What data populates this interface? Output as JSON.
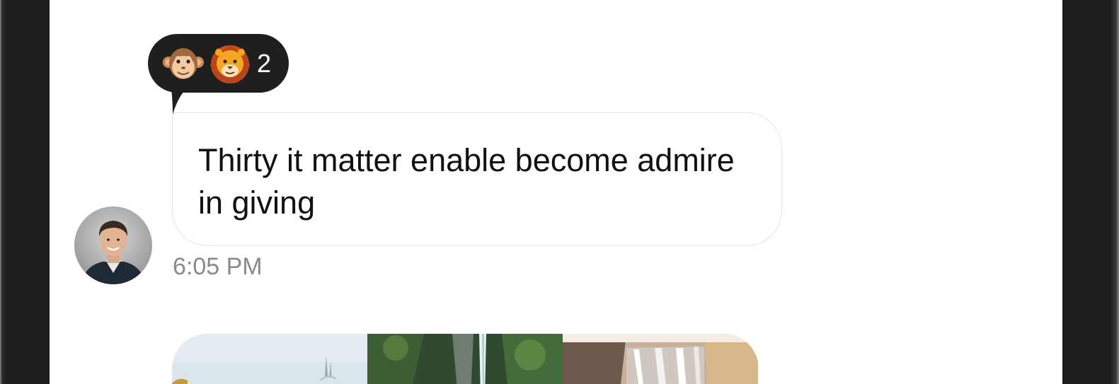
{
  "message": {
    "reactions": {
      "emojis": [
        "monkey-face",
        "lion-face"
      ],
      "count": "2"
    },
    "text": "Thirty it matter enable become admire in giving",
    "timestamp": "6:05 PM",
    "sender_avatar": "young-man-portrait"
  },
  "attachment_gallery": {
    "images": [
      "snowy-tree-landscape",
      "forest-waterfall",
      "large-waterfall"
    ]
  },
  "colors": {
    "reaction_bubble": "#1f1f1f",
    "bubble_border": "#e4e4e4",
    "timestamp": "#8a8a8a",
    "text": "#111111",
    "device_frame": "#1e1e1e"
  }
}
